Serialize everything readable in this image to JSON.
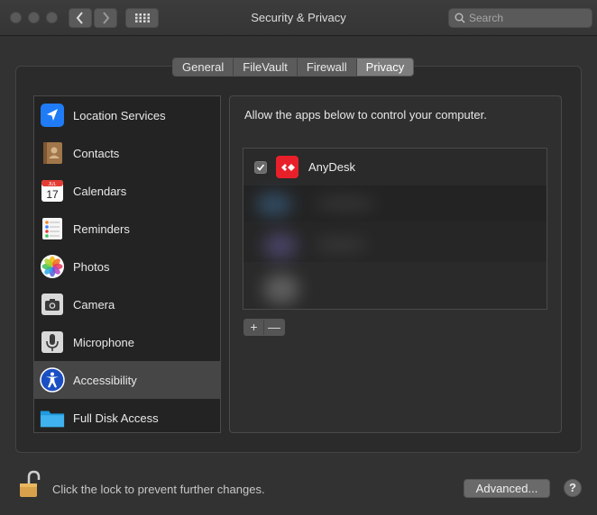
{
  "window": {
    "title": "Security & Privacy",
    "search_placeholder": "Search"
  },
  "tabs": [
    {
      "label": "General",
      "active": false
    },
    {
      "label": "FileVault",
      "active": false
    },
    {
      "label": "Firewall",
      "active": false
    },
    {
      "label": "Privacy",
      "active": true
    }
  ],
  "sidebar": {
    "items": [
      {
        "label": "Location Services",
        "icon": "location-arrow-icon"
      },
      {
        "label": "Contacts",
        "icon": "contacts-book-icon"
      },
      {
        "label": "Calendars",
        "icon": "calendar-icon",
        "calendar_month": "JUL",
        "calendar_day": "17"
      },
      {
        "label": "Reminders",
        "icon": "reminders-list-icon"
      },
      {
        "label": "Photos",
        "icon": "photos-flower-icon"
      },
      {
        "label": "Camera",
        "icon": "camera-icon"
      },
      {
        "label": "Microphone",
        "icon": "microphone-icon"
      },
      {
        "label": "Accessibility",
        "icon": "accessibility-icon",
        "selected": true
      },
      {
        "label": "Full Disk Access",
        "icon": "folder-icon"
      }
    ]
  },
  "main": {
    "instruction": "Allow the apps below to control your computer.",
    "apps": [
      {
        "name": "AnyDesk",
        "checked": true,
        "icon": "anydesk-icon"
      }
    ],
    "add_label": "+",
    "remove_label": "—"
  },
  "footer": {
    "lock_text": "Click the lock to prevent further changes.",
    "advanced_label": "Advanced...",
    "help_label": "?"
  },
  "colors": {
    "window_bg": "#323232",
    "selected_row": "#464646",
    "anydesk_red": "#e8202a",
    "lock_gold": "#d8a14a"
  }
}
